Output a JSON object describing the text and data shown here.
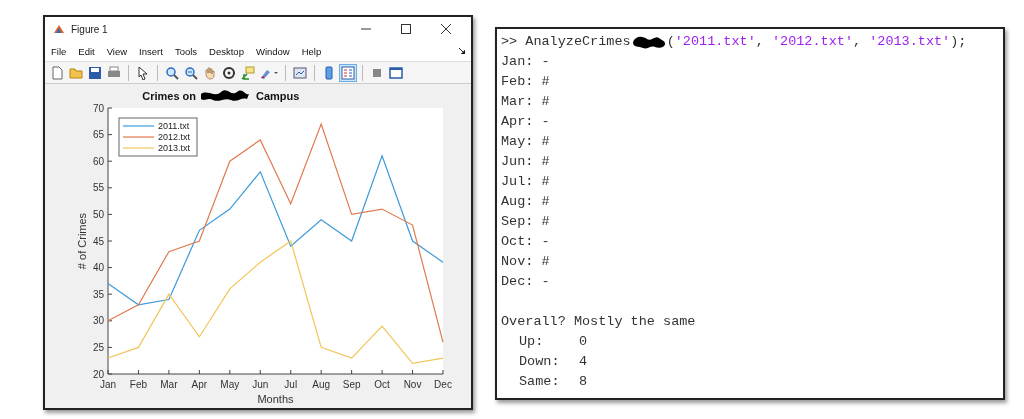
{
  "figure_window": {
    "title": "Figure 1",
    "menu": [
      "File",
      "Edit",
      "View",
      "Insert",
      "Tools",
      "Desktop",
      "Window",
      "Help"
    ],
    "toolbar": [
      {
        "kind": "new"
      },
      {
        "kind": "open"
      },
      {
        "kind": "save"
      },
      {
        "kind": "print"
      },
      {
        "kind": "sep"
      },
      {
        "kind": "pointer"
      },
      {
        "kind": "sep"
      },
      {
        "kind": "zoomin"
      },
      {
        "kind": "zoomout"
      },
      {
        "kind": "pan"
      },
      {
        "kind": "rotate"
      },
      {
        "kind": "cursor"
      },
      {
        "kind": "brush"
      },
      {
        "kind": "sep"
      },
      {
        "kind": "link"
      },
      {
        "kind": "sep"
      },
      {
        "kind": "colorbar",
        "selected": false
      },
      {
        "kind": "legend",
        "selected": true
      },
      {
        "kind": "sep"
      },
      {
        "kind": "hide"
      },
      {
        "kind": "dock"
      }
    ],
    "plot_title_parts": [
      "Crimes on",
      "Campus"
    ],
    "chart_data": {
      "type": "line",
      "legend": true,
      "xlabel": "Months",
      "ylabel": "# of Crimes",
      "categories": [
        "Jan",
        "Feb",
        "Mar",
        "Apr",
        "May",
        "Jun",
        "Jul",
        "Aug",
        "Sep",
        "Oct",
        "Nov",
        "Dec"
      ],
      "ylim": [
        20,
        70
      ],
      "yticks": [
        20,
        25,
        30,
        35,
        40,
        45,
        50,
        55,
        60,
        65,
        70
      ],
      "series": [
        {
          "name": "2011.txt",
          "color": "#3d9ad8",
          "values": [
            37,
            33,
            34,
            47,
            51,
            58,
            44,
            49,
            45,
            61,
            45,
            41
          ]
        },
        {
          "name": "2012.txt",
          "color": "#e07a50",
          "values": [
            30,
            33,
            43,
            45,
            60,
            64,
            52,
            67,
            50,
            51,
            48,
            26
          ]
        },
        {
          "name": "2013.txt",
          "color": "#f2c45a",
          "values": [
            23,
            25,
            35,
            27,
            36,
            41,
            45,
            25,
            23,
            29,
            22,
            23
          ]
        }
      ]
    }
  },
  "console": {
    "prompt": ">>",
    "command": "AnalyzeCrimes",
    "args": [
      {
        "kind": "punct",
        "text": "("
      },
      {
        "kind": "string",
        "text": "'2011.txt'"
      },
      {
        "kind": "punct",
        "text": ", "
      },
      {
        "kind": "string",
        "text": "'2012.txt'"
      },
      {
        "kind": "punct",
        "text": ", "
      },
      {
        "kind": "string",
        "text": "'2013.txt'"
      },
      {
        "kind": "punct",
        "text": ");"
      }
    ],
    "lines": [
      "Jan: -",
      "Feb: #",
      "Mar: #",
      "Apr: -",
      "May: #",
      "Jun: #",
      "Jul: #",
      "Aug: #",
      "Sep: #",
      "Oct: -",
      "Nov: #",
      "Dec: -"
    ],
    "overall": "Overall? Mostly the same",
    "counts": [
      {
        "label": "Up:",
        "value": "0"
      },
      {
        "label": "Down:",
        "value": "4"
      },
      {
        "label": "Same:",
        "value": "8"
      }
    ]
  }
}
